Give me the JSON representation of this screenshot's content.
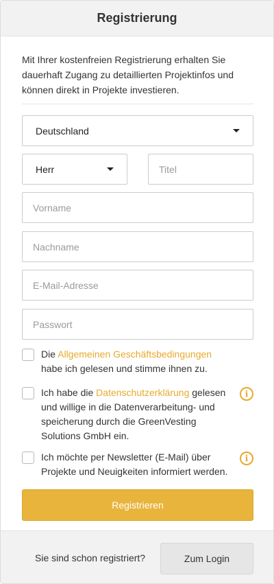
{
  "header": {
    "title": "Registrierung"
  },
  "intro": {
    "text": "Mit Ihrer kostenfreien Registrierung erhalten Sie dauerhaft Zugang zu detaillierten Projektinfos und können direkt in Projekte investieren."
  },
  "form": {
    "country": {
      "value": "Deutschland"
    },
    "salutation": {
      "value": "Herr"
    },
    "title": {
      "placeholder": "Titel"
    },
    "firstname": {
      "placeholder": "Vorname"
    },
    "lastname": {
      "placeholder": "Nachname"
    },
    "email": {
      "placeholder": "E-Mail-Adresse"
    },
    "password": {
      "placeholder": "Passwort"
    }
  },
  "consents": {
    "agb": {
      "pre": "Die ",
      "link": "Allgemeinen Geschäftsbedingungen",
      "post": " habe ich gelesen und stimme ihnen zu."
    },
    "privacy": {
      "pre": "Ich habe die ",
      "link": "Datenschutzerklärung",
      "post": " gelesen und willige in die Datenverarbeitung- und speicherung durch die GreenVesting Solutions GmbH ein.",
      "icon": "info-icon"
    },
    "newsletter": {
      "text": "Ich möchte per Newsletter (E-Mail) über Projekte und Neuigkeiten informiert werden.",
      "icon": "info-icon"
    }
  },
  "submit": {
    "label": "Registrieren"
  },
  "footer": {
    "question": "Sie sind schon registriert?",
    "login_label": "Zum Login"
  },
  "colors": {
    "accent": "#e8b43c",
    "link": "#e8a92b",
    "header_bg": "#f2f2f2"
  }
}
